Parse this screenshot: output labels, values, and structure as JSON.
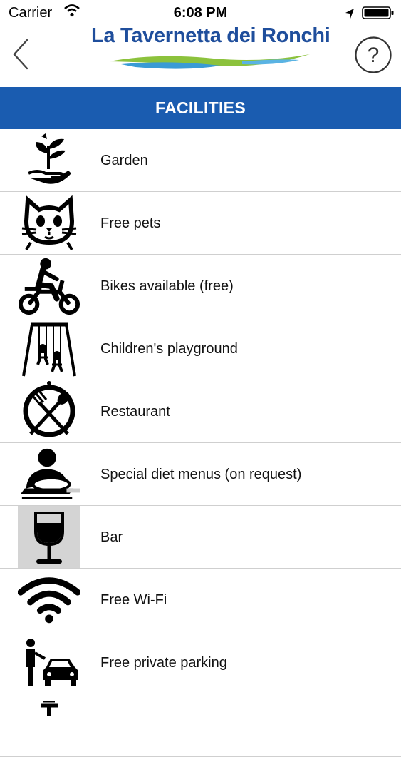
{
  "status": {
    "carrier": "Carrier",
    "time": "6:08 PM"
  },
  "header": {
    "logo_text": "La Tavernetta dei Ronchi",
    "back_icon": "chevron-left-icon",
    "help_icon": "question-circle-icon"
  },
  "title": "FACILITIES",
  "facilities": [
    {
      "label": "Garden",
      "icon": "garden-icon"
    },
    {
      "label": "Free pets",
      "icon": "cat-icon"
    },
    {
      "label": "Bikes available (free)",
      "icon": "motorbike-icon"
    },
    {
      "label": "Children's playground",
      "icon": "swing-icon"
    },
    {
      "label": "Restaurant",
      "icon": "restaurant-icon"
    },
    {
      "label": "Special diet menus (on request)",
      "icon": "diet-menu-icon"
    },
    {
      "label": "Bar",
      "icon": "wine-glass-icon"
    },
    {
      "label": "Free Wi-Fi",
      "icon": "wifi-icon"
    },
    {
      "label": "Free private parking",
      "icon": "parking-icon"
    }
  ],
  "colors": {
    "title_bar": "#1a5cb0",
    "logo_text": "#1f4e9c"
  }
}
